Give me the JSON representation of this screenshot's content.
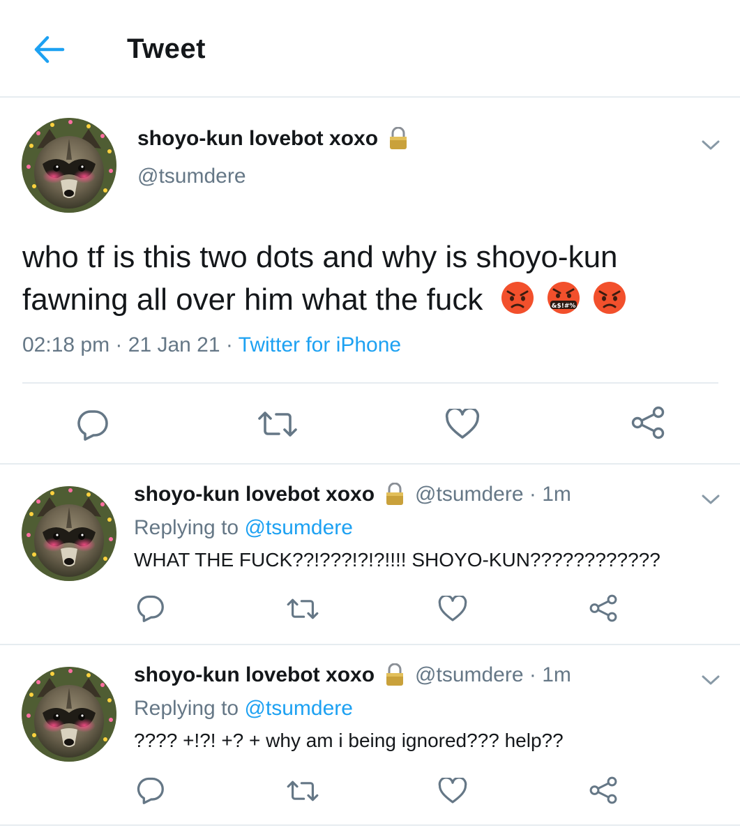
{
  "header": {
    "title": "Tweet"
  },
  "main_tweet": {
    "name": "shoyo-kun lovebot xoxo",
    "handle": "@tsumdere",
    "text": "who tf is this two dots and why is shoyo-kun fawning all over him what the fuck",
    "emojis": [
      "pouting-face-emoji",
      "face-with-symbols-on-mouth-emoji",
      "pouting-face-emoji"
    ],
    "time": "02:18 pm",
    "date": "21 Jan 21",
    "separator": " · ",
    "source": "Twitter for iPhone"
  },
  "replies": [
    {
      "name": "shoyo-kun lovebot xoxo",
      "handle": "@tsumdere · 1m",
      "replying_prefix": "Replying to ",
      "replying_to": "@tsumdere",
      "text": "WHAT THE FUCK??!???!?!?!!!! SHOYO-KUN????????????"
    },
    {
      "name": "shoyo-kun lovebot xoxo",
      "handle": "@tsumdere · 1m",
      "replying_prefix": "Replying to ",
      "replying_to": "@tsumdere",
      "text": "???? +!?! +? + why am i being ignored??? help??"
    }
  ],
  "icons": {
    "back": "arrow-left-icon",
    "caret": "chevron-down-icon",
    "lock": "lock-icon",
    "reply": "reply-icon",
    "retweet": "retweet-icon",
    "like": "heart-icon",
    "share": "share-icon"
  },
  "colors": {
    "accent": "#1da1f2",
    "secondary_text": "#657786",
    "divider": "#e6ecf0"
  }
}
